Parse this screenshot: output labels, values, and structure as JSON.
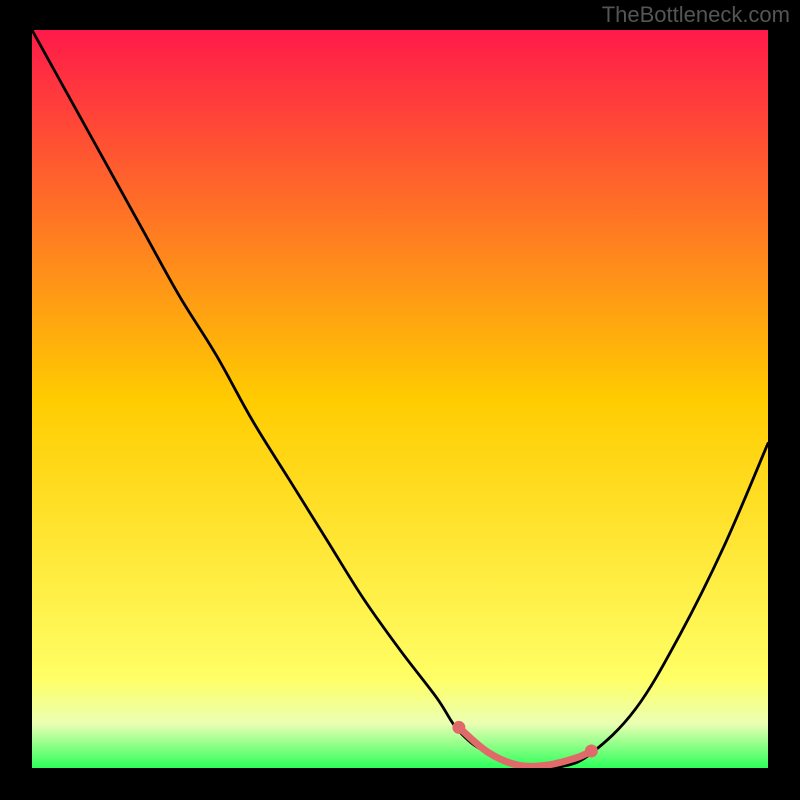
{
  "watermark": "TheBottleneck.com",
  "chart_data": {
    "type": "line",
    "title": "",
    "xlabel": "",
    "ylabel": "",
    "xlim": [
      0,
      100
    ],
    "ylim": [
      0,
      100
    ],
    "gradient_stops": [
      {
        "offset": 0,
        "color": "#ff1a4a"
      },
      {
        "offset": 50,
        "color": "#ffcc00"
      },
      {
        "offset": 88,
        "color": "#ffff66"
      },
      {
        "offset": 94,
        "color": "#eaffb3"
      },
      {
        "offset": 100,
        "color": "#2dff5a"
      }
    ],
    "series": [
      {
        "name": "bottleneck-curve",
        "color": "#000000",
        "x": [
          0,
          5,
          10,
          15,
          20,
          25,
          30,
          35,
          40,
          45,
          50,
          55,
          58,
          62,
          68,
          72,
          76,
          82,
          88,
          94,
          100
        ],
        "y": [
          100,
          91,
          82,
          73,
          64,
          56,
          47,
          39,
          31,
          23,
          16,
          9.5,
          5,
          2,
          0.2,
          0.2,
          2,
          8,
          18,
          30,
          44
        ]
      }
    ],
    "highlight_segment": {
      "name": "flat-bottom",
      "color": "#e06a6a",
      "x": [
        58,
        62,
        66,
        70,
        74,
        76
      ],
      "y": [
        5.5,
        2.1,
        0.4,
        0.4,
        1.4,
        2.3
      ]
    },
    "highlight_dots": {
      "name": "highlight-endpoints",
      "color": "#e06a6a",
      "points": [
        {
          "x": 58,
          "y": 5.5
        },
        {
          "x": 76,
          "y": 2.3
        }
      ]
    }
  }
}
